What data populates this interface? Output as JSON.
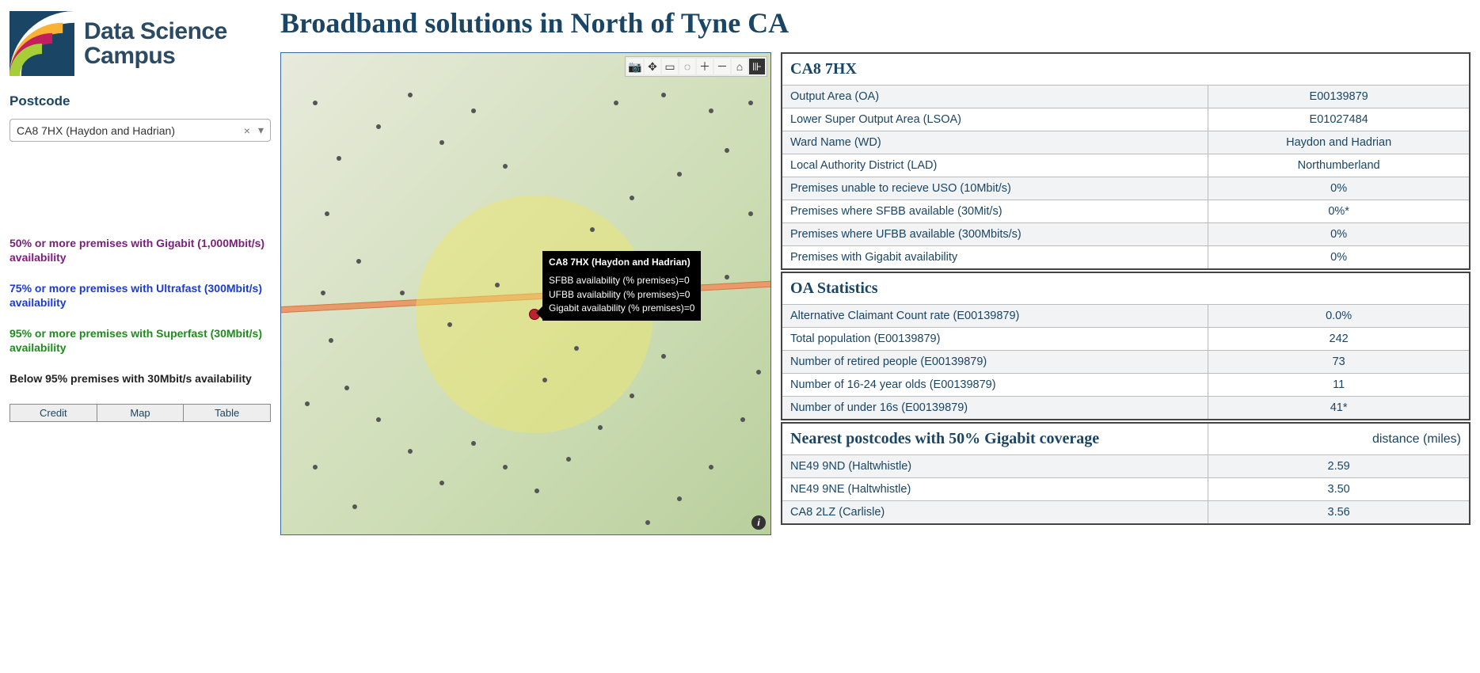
{
  "brand": {
    "line1": "Data Science",
    "line2": "Campus"
  },
  "sidebar": {
    "postcode_label": "Postcode",
    "postcode_value": "CA8 7HX (Haydon and Hadrian)",
    "legend": {
      "gigabit": "50% or more premises with Gigabit (1,000Mbit/s) availability",
      "ultrafast": "75% or more premises with Ultrafast (300Mbit/s) availability",
      "superfast": "95% or more premises with Superfast (30Mbit/s) availability",
      "below": "Below 95% premises with 30Mbit/s availability"
    },
    "tabs": {
      "credit": "Credit",
      "map": "Map",
      "table": "Table"
    }
  },
  "page": {
    "title": "Broadband solutions in North of Tyne CA"
  },
  "tooltip": {
    "title": "CA8 7HX (Haydon and Hadrian)",
    "l1": "SFBB availability (% premises)=0",
    "l2": "UFBB availability (% premises)=0",
    "l3": "Gigabit availability (% premises)=0"
  },
  "panel": {
    "h1": "CA8 7HX",
    "rows1": [
      {
        "label": "Output Area (OA)",
        "value": "E00139879"
      },
      {
        "label": "Lower Super Output Area (LSOA)",
        "value": "E01027484"
      },
      {
        "label": "Ward Name (WD)",
        "value": "Haydon and Hadrian"
      },
      {
        "label": "Local Authority District (LAD)",
        "value": "Northumberland"
      },
      {
        "label": "Premises unable to recieve USO (10Mbit/s)",
        "value": "0%"
      },
      {
        "label": "Premises where SFBB available (30Mit/s)",
        "value": "0%*"
      },
      {
        "label": "Premises where UFBB available (300Mbits/s)",
        "value": "0%"
      },
      {
        "label": "Premises with Gigabit availability",
        "value": "0%"
      }
    ],
    "h2": "OA Statistics",
    "rows2": [
      {
        "label": "Alternative Claimant Count rate (E00139879)",
        "value": "0.0%"
      },
      {
        "label": "Total population (E00139879)",
        "value": "242"
      },
      {
        "label": "Number of retired people (E00139879)",
        "value": "73"
      },
      {
        "label": "Number of 16-24 year olds (E00139879)",
        "value": "11"
      },
      {
        "label": "Number of under 16s (E00139879)",
        "value": "41*"
      }
    ],
    "h3": "Nearest postcodes with 50% Gigabit coverage",
    "h3r": "distance (miles)",
    "rows3": [
      {
        "label": "NE49 9ND (Haltwhistle)",
        "value": "2.59"
      },
      {
        "label": "NE49 9NE (Haltwhistle)",
        "value": "3.50"
      },
      {
        "label": "CA8 2LZ (Carlisle)",
        "value": "3.56"
      }
    ]
  }
}
